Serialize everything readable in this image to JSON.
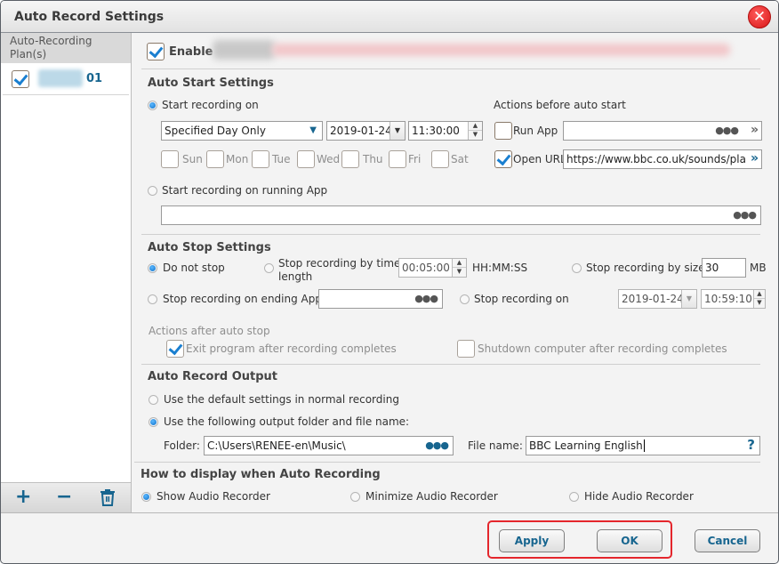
{
  "window": {
    "title": "Auto Record Settings",
    "close_icon": "close-icon"
  },
  "sidebar": {
    "header": "Auto-Recording Plan(s)",
    "plans": [
      {
        "checked": true,
        "name_suffix": "01"
      }
    ],
    "toolbar": {
      "add": "+",
      "remove": "−",
      "delete_icon": "trash-icon"
    }
  },
  "enable": {
    "label": "Enable",
    "checked": true
  },
  "auto_start": {
    "title": "Auto Start Settings",
    "start_on_label": "Start recording on",
    "schedule_select": "Specified Day Only",
    "date": "2019-01-24",
    "time": "11:30:00",
    "days": [
      "Sun",
      "Mon",
      "Tue",
      "Wed",
      "Thu",
      "Fri",
      "Sat"
    ],
    "running_app_label": "Start recording on running App",
    "running_app_value": "",
    "actions_title": "Actions before auto start",
    "run_app_label": "Run App",
    "run_app_value": "",
    "open_url_label": "Open URL",
    "open_url_value": "https://www.bbc.co.uk/sounds/pla"
  },
  "auto_stop": {
    "title": "Auto Stop Settings",
    "do_not_stop": "Do not stop",
    "by_time_label": "Stop recording by time length",
    "by_time_line1": "Stop recording by time",
    "by_time_line2": "length",
    "time_length": "00:05:00",
    "time_format": "HH:MM:SS",
    "by_size_label": "Stop recording by size",
    "size_value": "30",
    "size_unit": "MB",
    "ending_app_label": "Stop recording on ending App",
    "ending_app_value": "",
    "stop_on_label": "Stop recording on",
    "stop_date": "2019-01-24",
    "stop_time": "10:59:10",
    "actions_title": "Actions after auto stop",
    "exit_program": "Exit program after recording completes",
    "shutdown": "Shutdown computer after recording completes"
  },
  "output": {
    "title": "Auto Record Output",
    "default_label": "Use the default settings in normal recording",
    "custom_label": "Use the following output folder and file name:",
    "folder_label": "Folder:",
    "folder_value": "C:\\Users\\RENEE-en\\Music\\",
    "filename_label": "File name:",
    "filename_value": "BBC Learning English",
    "help": "?"
  },
  "display": {
    "title": "How to display when Auto Recording",
    "options": [
      "Show Audio Recorder",
      "Minimize Audio Recorder",
      "Hide Audio Recorder"
    ],
    "selected": "Show Audio Recorder"
  },
  "footer": {
    "apply": "Apply",
    "ok": "OK",
    "cancel": "Cancel",
    "highlight_color": "#e4262c"
  },
  "colors": {
    "accent": "#17658f",
    "check": "#1a7fd0",
    "close": "#d81818"
  }
}
